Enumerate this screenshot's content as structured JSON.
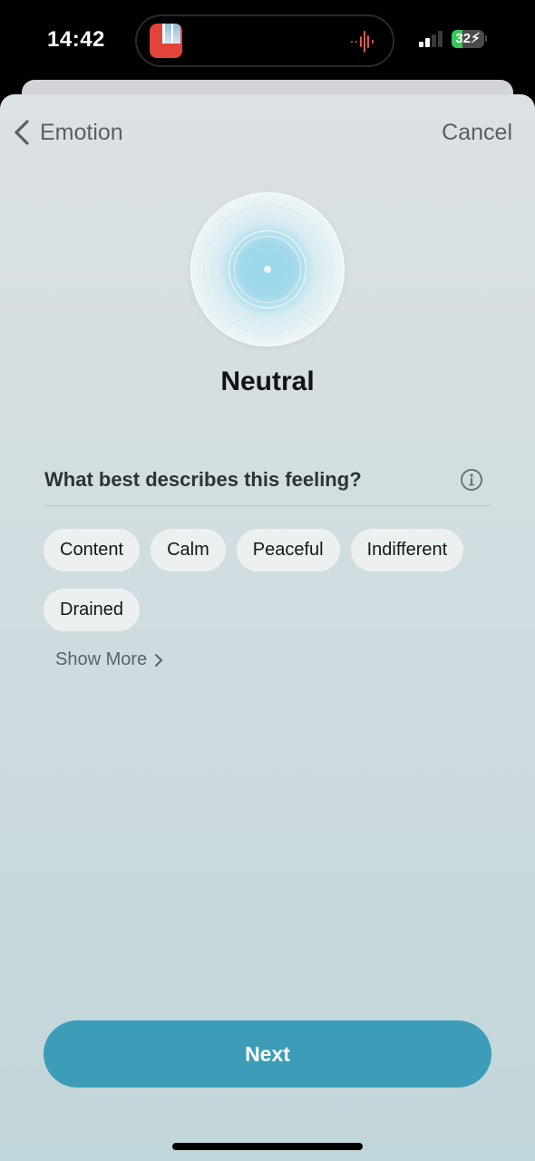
{
  "status_bar": {
    "time": "14:42",
    "battery_level": "32",
    "battery_percent": 0.32,
    "battery_charging": true,
    "signal_bars_active": 2,
    "signal_bars_total": 4,
    "recording_indicator_color": "#d9584f"
  },
  "nav": {
    "back_label": "Emotion",
    "cancel_label": "Cancel"
  },
  "emotion": {
    "name": "Neutral"
  },
  "question": {
    "text": "What best describes this feeling?"
  },
  "chips": [
    {
      "label": "Content"
    },
    {
      "label": "Calm"
    },
    {
      "label": "Peaceful"
    },
    {
      "label": "Indifferent"
    },
    {
      "label": "Drained"
    }
  ],
  "show_more": {
    "label": "Show More"
  },
  "footer": {
    "next_label": "Next"
  },
  "colors": {
    "accent": "#3d9db8",
    "chip_bg": "#ecf0f1",
    "battery_green": "#34c759"
  }
}
